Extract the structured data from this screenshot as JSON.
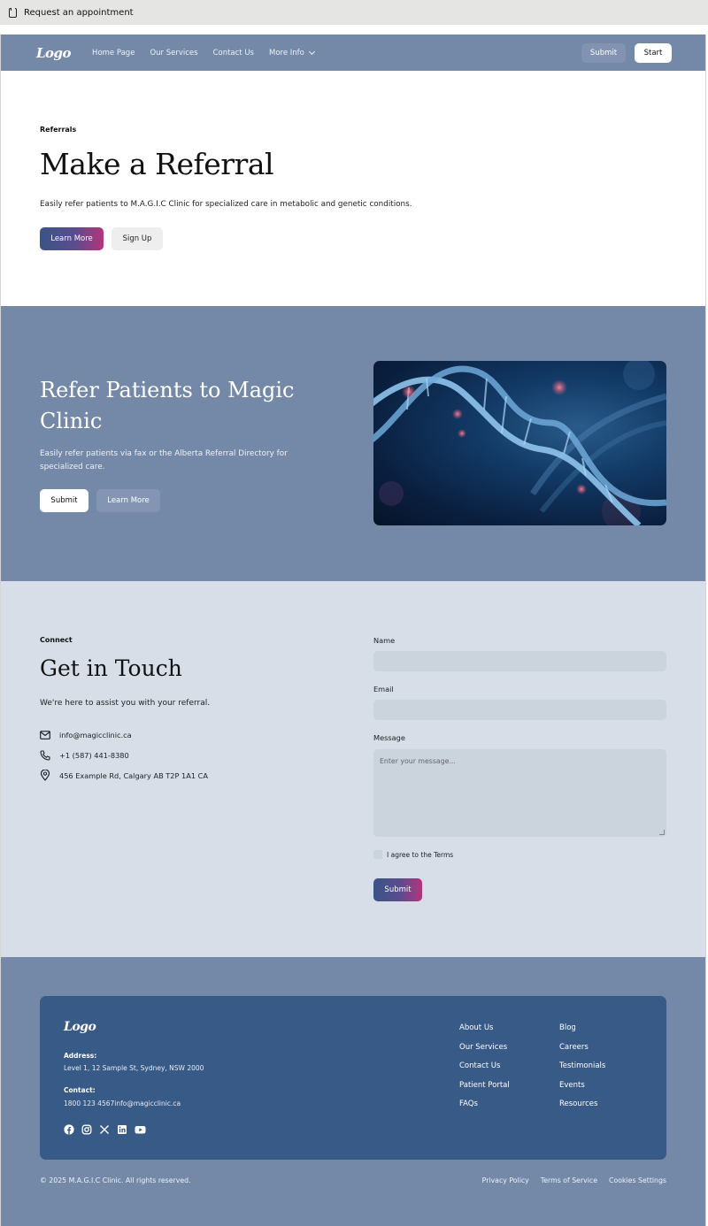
{
  "browser": {
    "title": "Request an appointment"
  },
  "nav": {
    "logo": "Logo",
    "links": [
      "Home Page",
      "Our Services",
      "Contact Us",
      "More Info"
    ],
    "submit": "Submit",
    "start": "Start"
  },
  "hero": {
    "eyebrow": "Referrals",
    "title": "Make a Referral",
    "subtitle": "Easily refer patients to M.A.G.I.C Clinic for specialized care in metabolic and genetic conditions.",
    "primary": "Learn More",
    "secondary": "Sign Up"
  },
  "refer": {
    "title": "Refer Patients to Magic Clinic",
    "description": "Easily refer patients via fax or the Alberta Referral Directory for specialized care.",
    "primary": "Submit",
    "secondary": "Learn More",
    "image_icon": "dna-helix-image"
  },
  "contact": {
    "eyebrow": "Connect",
    "title": "Get in Touch",
    "lead": "We're here to assist you with your referral.",
    "email": "info@magicclinic.ca",
    "phone": "+1 (587) 441-8380",
    "address": "456 Example Rd, Calgary AB T2P 1A1 CA",
    "form": {
      "name_label": "Name",
      "name_value": "",
      "email_label": "Email",
      "email_value": "",
      "message_label": "Message",
      "message_placeholder": "Enter your message...",
      "terms": "I agree to the Terms",
      "submit": "Submit"
    }
  },
  "footer": {
    "logo": "Logo",
    "address_label": "Address:",
    "address": "Level 1, 12 Sample St, Sydney, NSW 2000",
    "contact_label": "Contact:",
    "contact": "1800 123 4567info@magicclinic.ca",
    "socials": [
      "facebook-icon",
      "instagram-icon",
      "x-icon",
      "linkedin-icon",
      "youtube-icon"
    ],
    "col1": [
      "About Us",
      "Our Services",
      "Contact Us",
      "Patient Portal",
      "FAQs"
    ],
    "col2": [
      "Blog",
      "Careers",
      "Testimonials",
      "Events",
      "Resources"
    ],
    "copyright": "© 2025 M.A.G.I.C Clinic. All rights reserved.",
    "legal": [
      "Privacy Policy",
      "Terms of Service",
      "Cookies Settings"
    ]
  },
  "colors": {
    "nav_bg": "#7489a8",
    "contact_bg": "#d7dee8",
    "footer_card": "#385a87",
    "gradient_start": "#3a5488",
    "gradient_end": "#b5357a"
  }
}
